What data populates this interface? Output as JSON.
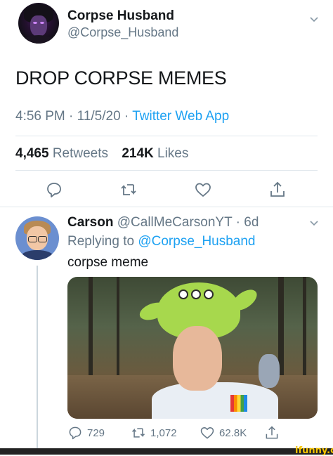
{
  "tweet": {
    "display_name": "Corpse Husband",
    "handle": "@Corpse_Husband",
    "text": "DROP CORPSE MEMES",
    "time": "4:56 PM",
    "date": "11/5/20",
    "source": "Twitter Web App",
    "separator": "·",
    "retweets_count": "4,465",
    "retweets_label": "Retweets",
    "likes_count": "214K",
    "likes_label": "Likes"
  },
  "reply": {
    "display_name": "Carson",
    "handle": "@CallMeCarsonYT",
    "age": "6d",
    "replying_to_label": "Replying to",
    "replying_to_handle": "@Corpse_Husband",
    "text": "corpse meme",
    "replies": "729",
    "retweets": "1,072",
    "likes": "62.8K"
  },
  "watermark": "ifunny.co",
  "colors": {
    "link": "#1da1f2",
    "muted": "#657786",
    "divider": "#e1e8ed"
  },
  "icons": [
    "chevron-down-icon",
    "reply-icon",
    "retweet-icon",
    "like-icon",
    "share-icon"
  ]
}
